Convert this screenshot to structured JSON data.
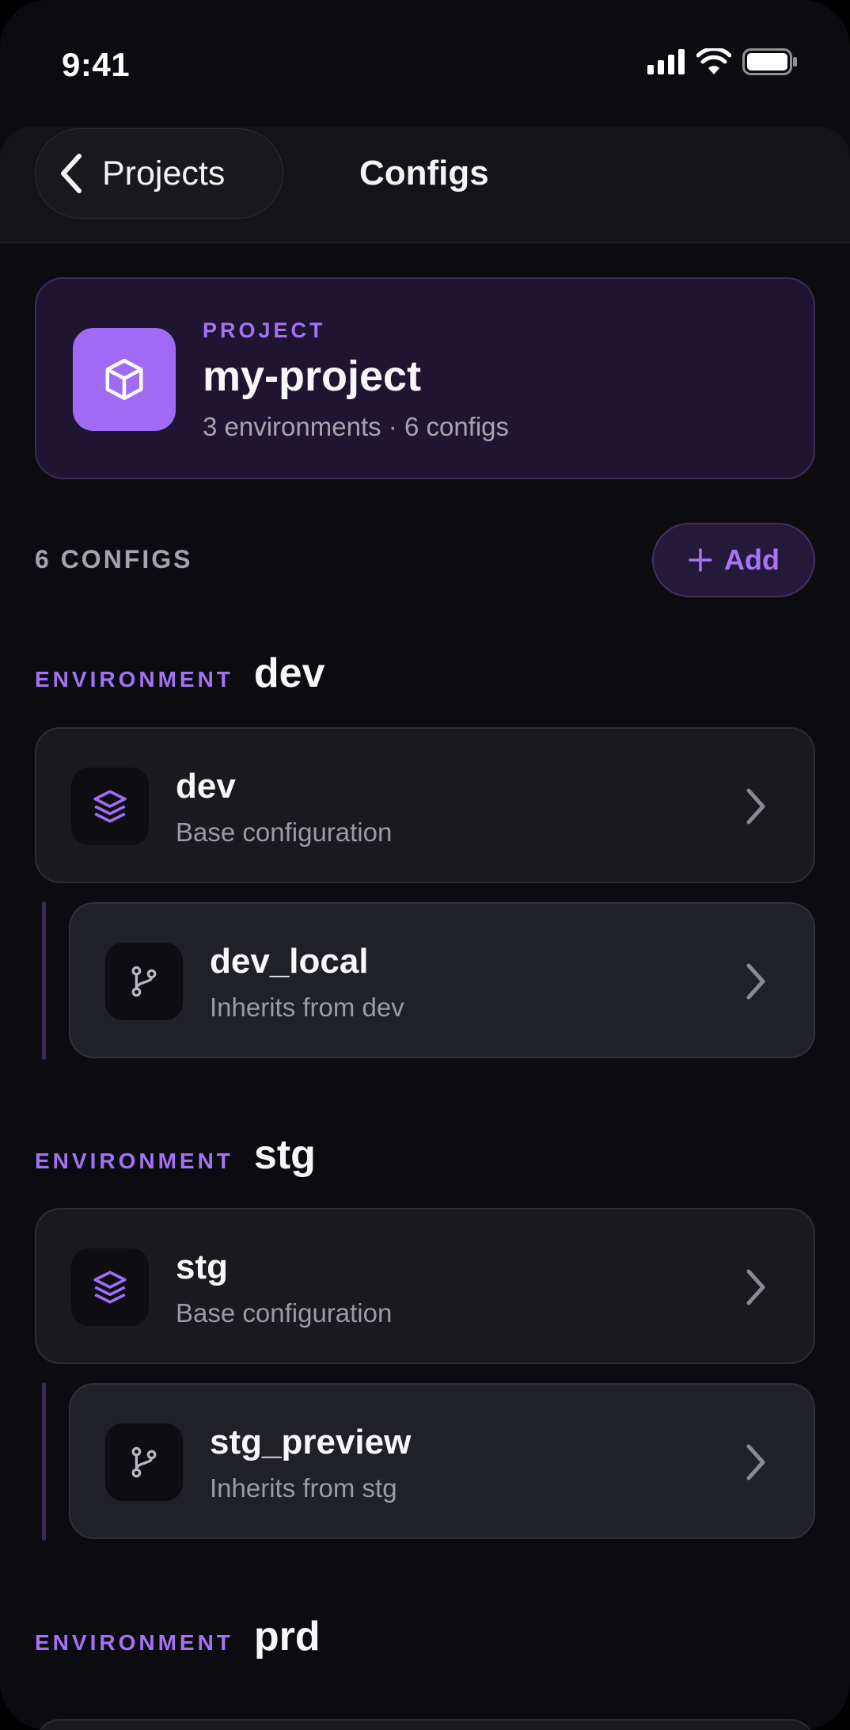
{
  "status_bar": {
    "time": "9:41"
  },
  "nav": {
    "back_label": "Projects",
    "title": "Configs"
  },
  "project": {
    "kicker": "PROJECT",
    "name": "my-project",
    "meta": "3 environments · 6 configs",
    "icon": "cube-icon",
    "accent": "#a06af5"
  },
  "configs_header": {
    "count_label": "6 CONFIGS",
    "add_label": "Add"
  },
  "environments": [
    {
      "kicker": "ENVIRONMENT",
      "name": "dev",
      "base": {
        "title": "dev",
        "subtitle": "Base configuration",
        "icon": "layers-icon"
      },
      "child": {
        "title": "dev_local",
        "subtitle": "Inherits from dev",
        "icon": "branch-icon"
      }
    },
    {
      "kicker": "ENVIRONMENT",
      "name": "stg",
      "base": {
        "title": "stg",
        "subtitle": "Base configuration",
        "icon": "layers-icon"
      },
      "child": {
        "title": "stg_preview",
        "subtitle": "Inherits from stg",
        "icon": "branch-icon"
      }
    },
    {
      "kicker": "ENVIRONMENT",
      "name": "prd"
    }
  ]
}
